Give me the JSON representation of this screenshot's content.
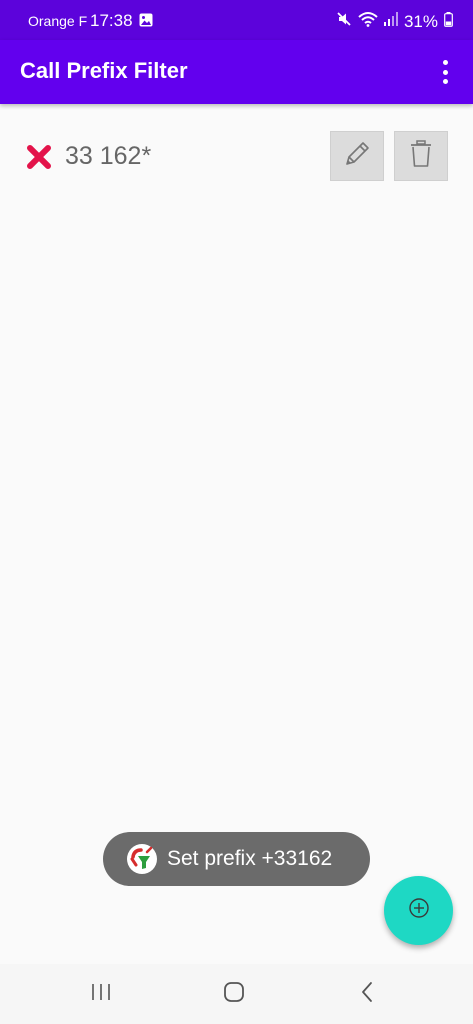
{
  "status_bar": {
    "carrier": "Orange F",
    "time": "17:38",
    "battery": "31%",
    "icons": [
      "photo-icon",
      "mute-icon",
      "wifi-icon",
      "signal-icon",
      "battery-icon"
    ]
  },
  "app_bar": {
    "title": "Call Prefix Filter",
    "menu_icon": "more-vert-icon"
  },
  "prefixes": [
    {
      "status_icon": "blocked-x-icon",
      "value": "33 162*",
      "edit_icon": "pencil-icon",
      "delete_icon": "trash-icon"
    }
  ],
  "toast": {
    "app_icon": "app-logo-icon",
    "text": "Set prefix +33162"
  },
  "fab": {
    "icon": "add-circle-icon"
  },
  "nav_bar": {
    "buttons": [
      "recents-icon",
      "home-icon",
      "back-icon"
    ]
  },
  "colors": {
    "status_bar": "#5c03db",
    "app_bar": "#6200ee",
    "background": "#fafafa",
    "blocked_icon": "#e3134a",
    "prefix_text": "#666666",
    "action_button": "#dcdcdc",
    "toast_bg": "#6b6b6b",
    "fab": "#1ed8c4",
    "nav_bar": "#f6f6f6"
  }
}
